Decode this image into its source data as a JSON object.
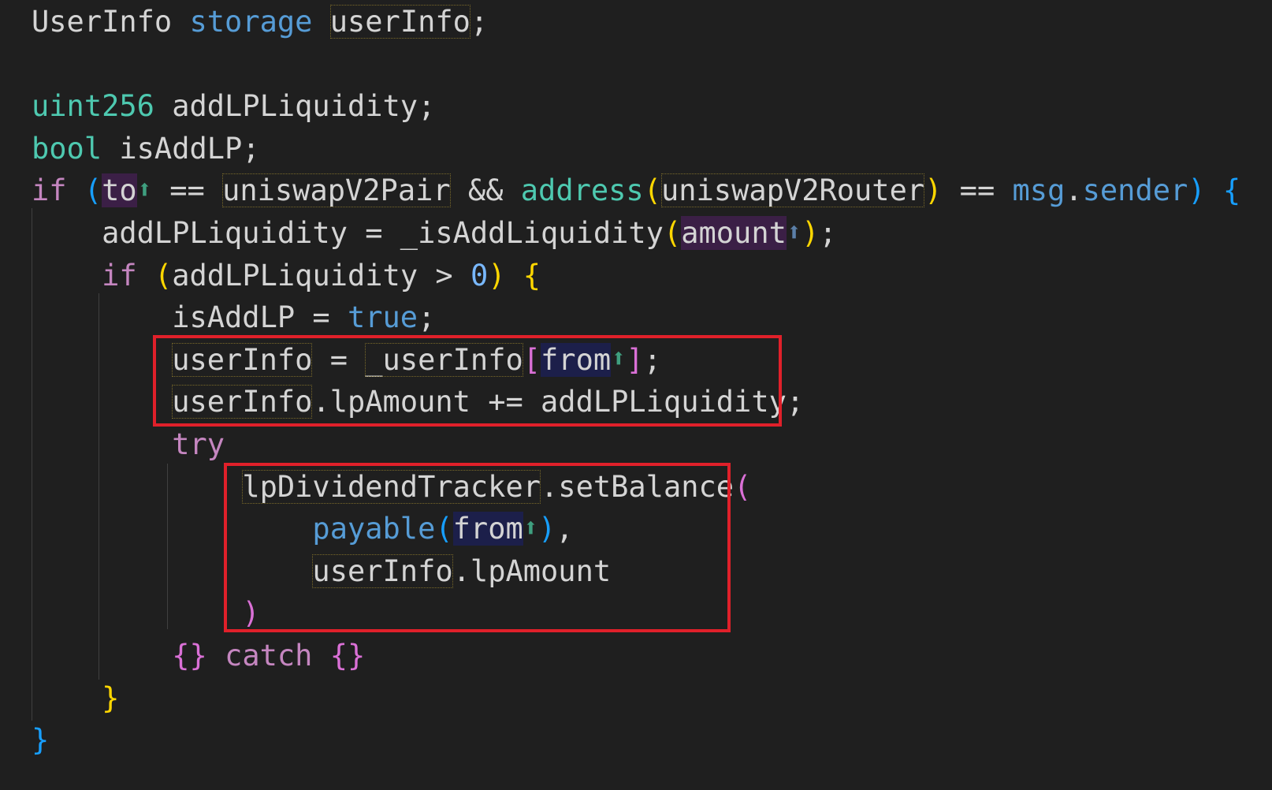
{
  "lines": [
    [
      {
        "t": "UserInfo",
        "c": "c-plain"
      },
      {
        "t": " ",
        "c": "c-plain"
      },
      {
        "t": "storage",
        "c": "c-kw"
      },
      {
        "t": " ",
        "c": "c-plain"
      },
      {
        "t": "userInfo",
        "c": "c-plain hl-box"
      },
      {
        "t": ";",
        "c": "c-plain"
      }
    ],
    [],
    [
      {
        "t": "uint256",
        "c": "c-type"
      },
      {
        "t": " addLPLiquidity;",
        "c": "c-plain"
      }
    ],
    [
      {
        "t": "bool",
        "c": "c-type"
      },
      {
        "t": " isAddLP;",
        "c": "c-plain"
      }
    ],
    [
      {
        "t": "if",
        "c": "c-ctrl"
      },
      {
        "t": " ",
        "c": "c-plain"
      },
      {
        "t": "(",
        "c": "c-brace3"
      },
      {
        "t": "to",
        "c": "c-plain hl-purple"
      },
      {
        "t": "⬆",
        "c": "arrow arrow-teal",
        "arrow": true
      },
      {
        "t": " == ",
        "c": "c-plain"
      },
      {
        "t": "uniswapV2Pair",
        "c": "c-plain hl-box"
      },
      {
        "t": " && ",
        "c": "c-plain"
      },
      {
        "t": "address",
        "c": "c-type"
      },
      {
        "t": "(",
        "c": "c-brace1"
      },
      {
        "t": "uniswapV2Router",
        "c": "c-plain hl-box"
      },
      {
        "t": ")",
        "c": "c-brace1"
      },
      {
        "t": " == ",
        "c": "c-plain"
      },
      {
        "t": "msg",
        "c": "c-kw"
      },
      {
        "t": ".",
        "c": "c-plain"
      },
      {
        "t": "sender",
        "c": "c-kw"
      },
      {
        "t": ")",
        "c": "c-brace3"
      },
      {
        "t": " ",
        "c": "c-plain"
      },
      {
        "t": "{",
        "c": "c-brace3"
      }
    ],
    [
      {
        "t": "    addLPLiquidity = _isAddLiquidity",
        "c": "c-plain"
      },
      {
        "t": "(",
        "c": "c-brace1"
      },
      {
        "t": "amount",
        "c": "c-plain hl-purple"
      },
      {
        "t": "⬆",
        "c": "arrow arrow-blue",
        "arrow": true
      },
      {
        "t": ")",
        "c": "c-brace1"
      },
      {
        "t": ";",
        "c": "c-plain"
      }
    ],
    [
      {
        "t": "    ",
        "c": "c-plain"
      },
      {
        "t": "if",
        "c": "c-ctrl"
      },
      {
        "t": " ",
        "c": "c-plain"
      },
      {
        "t": "(",
        "c": "c-brace1"
      },
      {
        "t": "addLPLiquidity > ",
        "c": "c-plain"
      },
      {
        "t": "0",
        "c": "c-num2"
      },
      {
        "t": ")",
        "c": "c-brace1"
      },
      {
        "t": " ",
        "c": "c-plain"
      },
      {
        "t": "{",
        "c": "c-brace1"
      }
    ],
    [
      {
        "t": "        isAddLP = ",
        "c": "c-plain"
      },
      {
        "t": "true",
        "c": "c-kw"
      },
      {
        "t": ";",
        "c": "c-plain"
      }
    ],
    [
      {
        "t": "        ",
        "c": "c-plain"
      },
      {
        "t": "userInfo",
        "c": "c-plain hl-box"
      },
      {
        "t": " = ",
        "c": "c-plain"
      },
      {
        "t": "_userInfo",
        "c": "c-plain hl-box"
      },
      {
        "t": "[",
        "c": "c-brace2"
      },
      {
        "t": "from",
        "c": "c-plain hl-navy"
      },
      {
        "t": "⬆",
        "c": "arrow arrow-teal",
        "arrow": true
      },
      {
        "t": "]",
        "c": "c-brace2"
      },
      {
        "t": ";",
        "c": "c-plain"
      }
    ],
    [
      {
        "t": "        ",
        "c": "c-plain"
      },
      {
        "t": "userInfo",
        "c": "c-plain hl-box"
      },
      {
        "t": ".lpAmount += addLPLiquidity;",
        "c": "c-plain"
      }
    ],
    [
      {
        "t": "        ",
        "c": "c-plain"
      },
      {
        "t": "try",
        "c": "c-ctrl"
      }
    ],
    [
      {
        "t": "            ",
        "c": "c-plain"
      },
      {
        "t": "lpDividendTracker",
        "c": "c-plain hl-box"
      },
      {
        "t": ".setBalance",
        "c": "c-plain"
      },
      {
        "t": "(",
        "c": "c-brace2"
      }
    ],
    [
      {
        "t": "                ",
        "c": "c-plain"
      },
      {
        "t": "payable",
        "c": "c-kw"
      },
      {
        "t": "(",
        "c": "c-brace3"
      },
      {
        "t": "from",
        "c": "c-plain hl-navy"
      },
      {
        "t": "⬆",
        "c": "arrow arrow-teal",
        "arrow": true
      },
      {
        "t": ")",
        "c": "c-brace3"
      },
      {
        "t": ",",
        "c": "c-plain"
      }
    ],
    [
      {
        "t": "                ",
        "c": "c-plain"
      },
      {
        "t": "userInfo",
        "c": "c-plain hl-box"
      },
      {
        "t": ".lpAmount",
        "c": "c-plain"
      }
    ],
    [
      {
        "t": "            ",
        "c": "c-plain"
      },
      {
        "t": ")",
        "c": "c-brace2"
      }
    ],
    [
      {
        "t": "        ",
        "c": "c-plain"
      },
      {
        "t": "{}",
        "c": "c-brace2"
      },
      {
        "t": " ",
        "c": "c-plain"
      },
      {
        "t": "catch",
        "c": "c-ctrl"
      },
      {
        "t": " ",
        "c": "c-plain"
      },
      {
        "t": "{}",
        "c": "c-brace2"
      }
    ],
    [
      {
        "t": "    ",
        "c": "c-plain"
      },
      {
        "t": "}",
        "c": "c-brace1"
      }
    ],
    [
      {
        "t": "}",
        "c": "c-brace3"
      }
    ]
  ],
  "colors": {
    "background": "#1f1f1f",
    "highlight_box": "#e0202a"
  }
}
